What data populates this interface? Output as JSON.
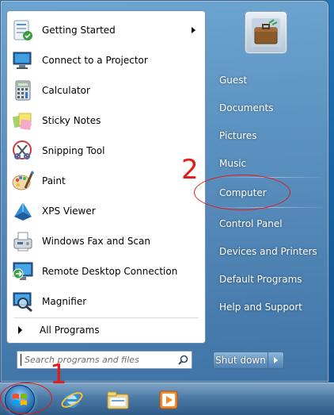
{
  "programs": [
    {
      "label": "Getting Started",
      "icon": "getting-started-icon",
      "has_submenu": true
    },
    {
      "label": "Connect to a Projector",
      "icon": "projector-icon"
    },
    {
      "label": "Calculator",
      "icon": "calculator-icon"
    },
    {
      "label": "Sticky Notes",
      "icon": "sticky-notes-icon"
    },
    {
      "label": "Snipping Tool",
      "icon": "scissors-icon"
    },
    {
      "label": "Paint",
      "icon": "paint-palette-icon"
    },
    {
      "label": "XPS Viewer",
      "icon": "xps-viewer-icon"
    },
    {
      "label": "Windows Fax and Scan",
      "icon": "fax-icon"
    },
    {
      "label": "Remote Desktop Connection",
      "icon": "remote-desktop-icon"
    },
    {
      "label": "Magnifier",
      "icon": "magnifier-icon"
    }
  ],
  "all_programs": "All Programs",
  "search": {
    "placeholder": "Search programs and files"
  },
  "right_items": [
    {
      "label": "Guest"
    },
    {
      "label": "Documents"
    },
    {
      "label": "Pictures"
    },
    {
      "label": "Music"
    },
    {
      "label": "Computer"
    },
    {
      "label": "Control Panel"
    },
    {
      "label": "Devices and Printers"
    },
    {
      "label": "Default Programs"
    },
    {
      "label": "Help and Support"
    }
  ],
  "shutdown": {
    "label": "Shut down"
  },
  "annotations": {
    "step1": "1",
    "step2": "2",
    "color": "#e41b17"
  },
  "taskbar": [
    "start-orb",
    "internet-explorer-icon",
    "windows-explorer-icon",
    "media-player-icon"
  ]
}
